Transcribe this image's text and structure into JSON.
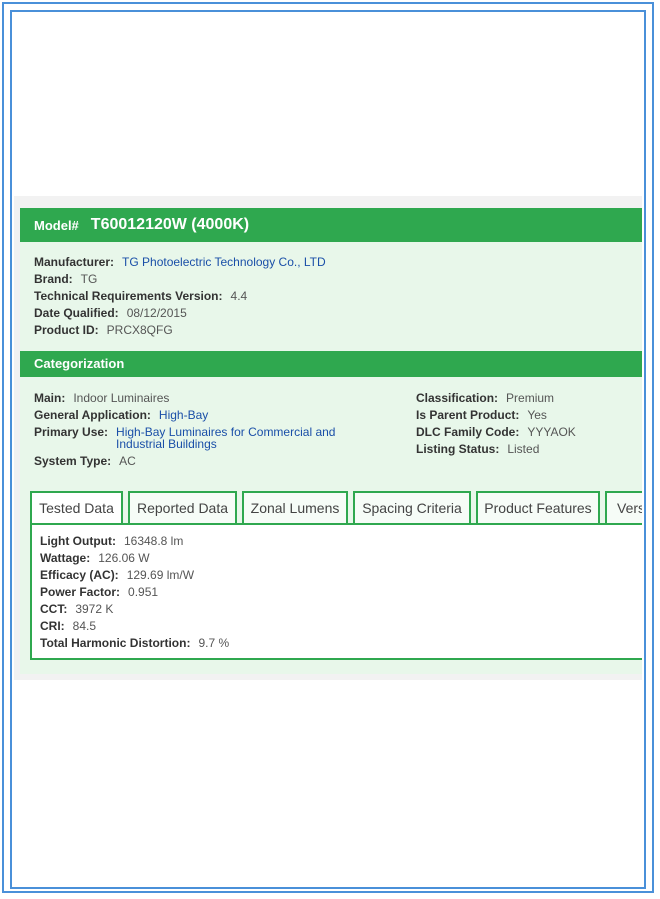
{
  "model": {
    "label": "Model#",
    "value": "T60012120W (4000K)"
  },
  "info": [
    {
      "label": "Manufacturer:",
      "value": "TG Photoelectric Technology Co., LTD"
    },
    {
      "label": "Brand:",
      "value": "TG"
    },
    {
      "label": "Technical Requirements Version:",
      "value": "4.4"
    },
    {
      "label": "Date Qualified:",
      "value": "08/12/2015"
    },
    {
      "label": "Product ID:",
      "value": "PRCX8QFG"
    }
  ],
  "categorization": {
    "title": "Categorization",
    "left": [
      {
        "label": "Main:",
        "value": "Indoor Luminaires"
      },
      {
        "label": "General Application:",
        "value": "High-Bay"
      },
      {
        "label": "Primary Use:",
        "value": "High-Bay Luminaires for Commercial and Industrial Buildings"
      },
      {
        "label": "System Type:",
        "value": "AC"
      }
    ],
    "right": [
      {
        "label": "Classification:",
        "value": "Premium"
      },
      {
        "label": "Is Parent Product:",
        "value": "Yes"
      },
      {
        "label": "DLC Family Code:",
        "value": "YYYAOK"
      },
      {
        "label": "Listing Status:",
        "value": "Listed"
      }
    ]
  },
  "tabs": [
    "Tested Data",
    "Reported Data",
    "Zonal Lumens",
    "Spacing Criteria",
    "Product Features",
    "Vers"
  ],
  "tested_data": [
    {
      "label": "Light Output:",
      "value": "16348.8 lm"
    },
    {
      "label": "Wattage:",
      "value": "126.06 W"
    },
    {
      "label": "Efficacy (AC):",
      "value": "129.69 lm/W"
    },
    {
      "label": "Power Factor:",
      "value": "0.951"
    },
    {
      "label": "CCT:",
      "value": "3972 K"
    },
    {
      "label": "CRI:",
      "value": "84.5"
    },
    {
      "label": "Total Harmonic Distortion:",
      "value": "9.7 %"
    }
  ],
  "colors": {
    "accent_green": "#2fa84f",
    "frame_blue": "#4a90d9",
    "link_blue": "#1a4fa8",
    "card_bg": "#e8f7ea"
  }
}
